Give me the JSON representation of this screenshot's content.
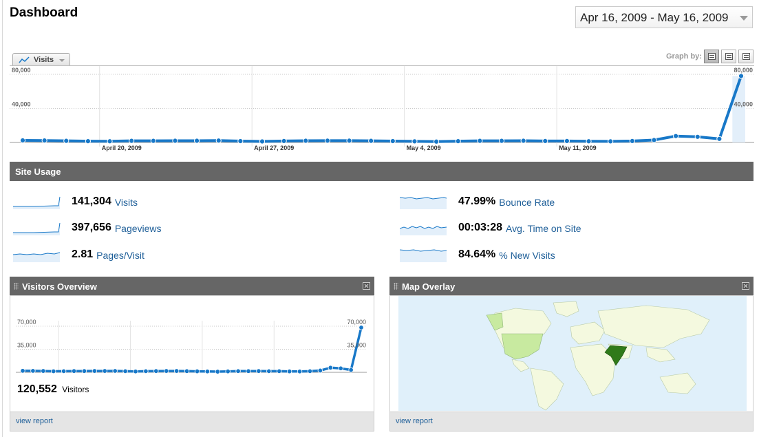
{
  "page": {
    "title": "Dashboard"
  },
  "date_range": {
    "label": "Apr 16, 2009 - May 16, 2009"
  },
  "metric_selector": {
    "label": "Visits",
    "icon": "line-chart-icon"
  },
  "graph_by": {
    "label": "Graph by:",
    "options": [
      {
        "icon": "graph-by-day-icon",
        "active": true
      },
      {
        "icon": "graph-by-week-icon",
        "active": false
      },
      {
        "icon": "graph-by-month-icon",
        "active": false
      }
    ]
  },
  "main_chart": {
    "type": "line",
    "y_ticks": [
      "80,000",
      "40,000"
    ],
    "ylim": [
      0,
      80000
    ],
    "week_labels": [
      "April 20, 2009",
      "April 27, 2009",
      "May 4, 2009",
      "May 11, 2009"
    ],
    "values": [
      2400,
      2300,
      1900,
      1500,
      1400,
      1900,
      1900,
      2000,
      2000,
      2200,
      1600,
      1200,
      1700,
      2000,
      2100,
      2100,
      1900,
      1600,
      1300,
      1000,
      1500,
      1900,
      1900,
      2000,
      1700,
      1700,
      1400,
      1300,
      1700,
      2800,
      7500,
      6600,
      4200,
      78000
    ],
    "color": "#1878c8"
  },
  "site_usage": {
    "title": "Site Usage",
    "metrics": [
      {
        "value": "141,304",
        "label": "Visits"
      },
      {
        "value": "397,656",
        "label": "Pageviews"
      },
      {
        "value": "2.81",
        "label": "Pages/Visit"
      },
      {
        "value": "47.99%",
        "label": "Bounce Rate"
      },
      {
        "value": "00:03:28",
        "label": "Avg. Time on Site"
      },
      {
        "value": "84.64%",
        "label": "% New Visits"
      }
    ]
  },
  "visitors_overview": {
    "title": "Visitors Overview",
    "chart": {
      "type": "line",
      "y_ticks": [
        "70,000",
        "35,000"
      ],
      "ylim": [
        0,
        70000
      ],
      "values": [
        2300,
        2200,
        2000,
        1600,
        1700,
        1900,
        1900,
        2000,
        2000,
        2100,
        1700,
        1300,
        1700,
        1900,
        2000,
        2000,
        1800,
        1500,
        1300,
        1000,
        1400,
        1800,
        1800,
        1900,
        1700,
        1700,
        1400,
        1300,
        1700,
        2700,
        7000,
        6000,
        3600,
        68000
      ]
    },
    "total_value": "120,552",
    "total_label": "Visitors",
    "link": "view report"
  },
  "map_overlay": {
    "title": "Map Overlay",
    "link": "view report",
    "colors": {
      "ocean": "#e0f0fa",
      "land": "#f4f9df",
      "low": "#c8eaa0",
      "high": "#2f7a1a"
    }
  },
  "colors": {
    "accent": "#1878c8",
    "link": "#1d5e98",
    "header_bar": "#666666"
  }
}
